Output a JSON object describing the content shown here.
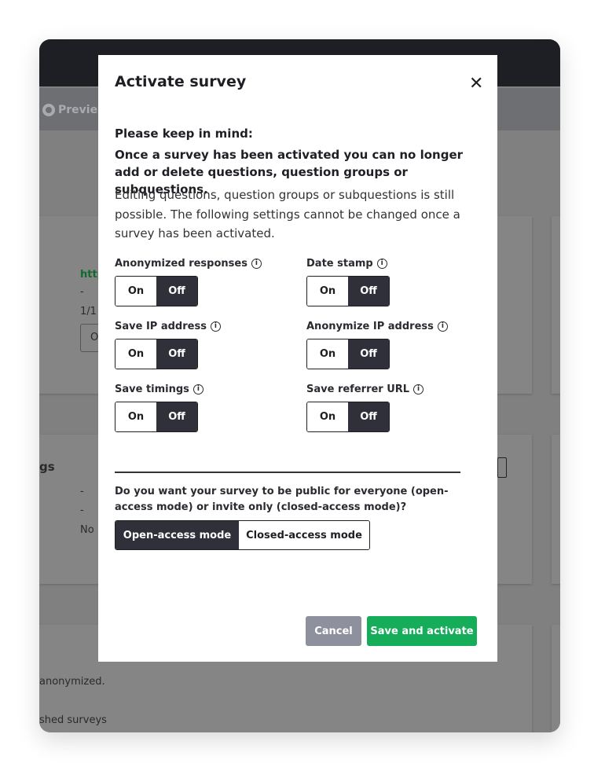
{
  "background": {
    "preview_label": "Preview",
    "link_fragment": "http",
    "dash1": "-",
    "fraction": "1/1",
    "input_fragment": "O",
    "section_fragment": "gs",
    "dash2": "-",
    "dash3": "-",
    "no": "No",
    "anonymized_fragment": "anonymized.",
    "surveys_fragment": "shed surveys"
  },
  "modal": {
    "title": "Activate survey",
    "close_icon": "close-icon",
    "heading": "Please keep in mind:",
    "warning": "Once a survey has been activated you can no longer add or delete questions, question groups or subquestions.",
    "description": "Editing questions, question groups or subquestions is still possible. The following settings cannot be changed once a survey has been activated.",
    "settings": [
      {
        "label": "Anonymized responses",
        "on": "On",
        "off": "Off",
        "value": "Off"
      },
      {
        "label": "Date stamp",
        "on": "On",
        "off": "Off",
        "value": "Off"
      },
      {
        "label": "Save IP address",
        "on": "On",
        "off": "Off",
        "value": "Off"
      },
      {
        "label": "Anonymize IP address",
        "on": "On",
        "off": "Off",
        "value": "Off"
      },
      {
        "label": "Save timings",
        "on": "On",
        "off": "Off",
        "value": "Off"
      },
      {
        "label": "Save referrer URL",
        "on": "On",
        "off": "Off",
        "value": "Off"
      }
    ],
    "access_question": "Do you want your survey to be public for everyone (open-access mode) or invite only (closed-access mode)?",
    "access_options": [
      "Open-access mode",
      "Closed-access mode"
    ],
    "access_selected": "Open-access mode",
    "cancel_label": "Cancel",
    "save_label": "Save and activate"
  },
  "colors": {
    "primary_dark": "#2f3039",
    "success": "#15ad59",
    "cancel": "#8f909e"
  }
}
